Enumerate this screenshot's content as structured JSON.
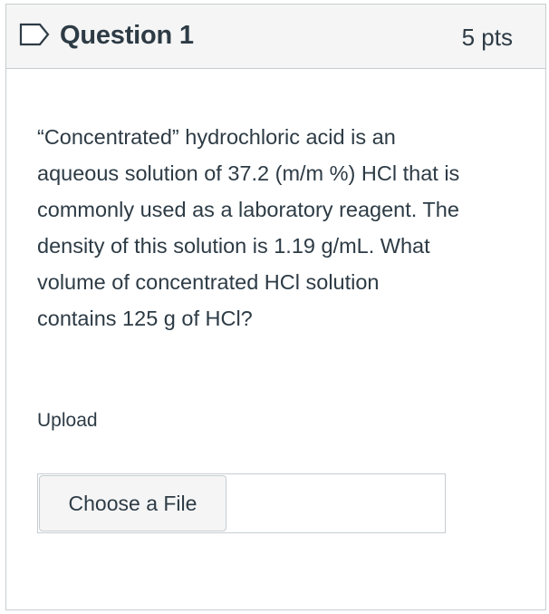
{
  "question": {
    "title": "Question 1",
    "points": "5 pts",
    "body_lines": [
      "“Concentrated” hydrochloric acid is an",
      "aqueous solution of 37.2 (m/m %) HCl that is",
      "commonly used as a laboratory reagent. The",
      "density of this solution is 1.19 g/mL.  What",
      "volume of concentrated HCl solution",
      "contains 125 g of HCl?"
    ]
  },
  "upload": {
    "label": "Upload",
    "choose_button": "Choose a File",
    "file_name": ""
  },
  "icons": {
    "flag": "flag-outline-icon"
  },
  "colors": {
    "text": "#2d3b45",
    "header_bg": "#f5f5f5",
    "border": "#c7cdd1"
  }
}
